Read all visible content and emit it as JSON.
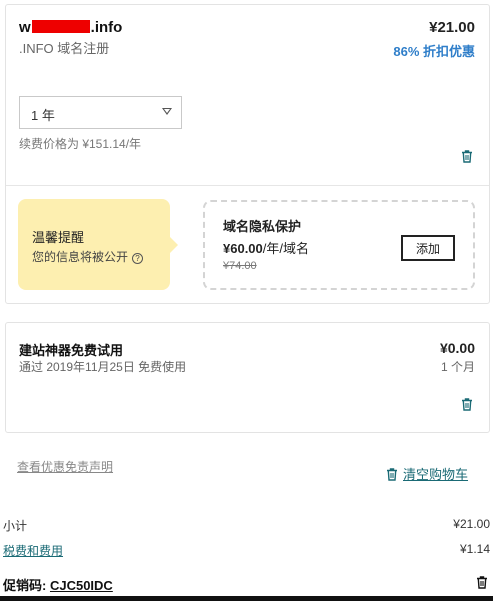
{
  "domain_item": {
    "name_prefix": "w",
    "name_suffix": ".info",
    "subtitle": ".INFO 域名注册",
    "price": "¥21.00",
    "discount": "86% 折扣优惠",
    "term_selected": "1 年",
    "renewal_text": "续费价格为 ¥151.14/年",
    "tip": {
      "title": "温馨提醒",
      "text": "您的信息将被公开",
      "help_glyph": "?"
    },
    "privacy": {
      "title": "域名隐私保护",
      "price": "¥60.00",
      "unit": "/年/域名",
      "old_price": "¥74.00",
      "add_label": "添加"
    }
  },
  "builder_item": {
    "title": "建站神器免费试用",
    "subtitle": "通过 2019年11月25日 免费使用",
    "price": "¥0.00",
    "period": "1 个月"
  },
  "links": {
    "disclaimer": "查看优惠免责声明",
    "clear_cart": "清空购物车"
  },
  "summary": {
    "subtotal_label": "小计",
    "subtotal_value": "¥21.00",
    "tax_label": "税费和费用",
    "tax_value": "¥1.14",
    "promo_label": "促销码:",
    "promo_code": "CJC50IDC"
  },
  "colors": {
    "accent_blue": "#2f7ec9",
    "link_teal": "#1a6a75",
    "tip_bg": "#fdefb0",
    "redaction": "#ee0000"
  },
  "icons": [
    "trash-icon",
    "help-circle-icon",
    "dropdown-arrow-icon"
  ]
}
